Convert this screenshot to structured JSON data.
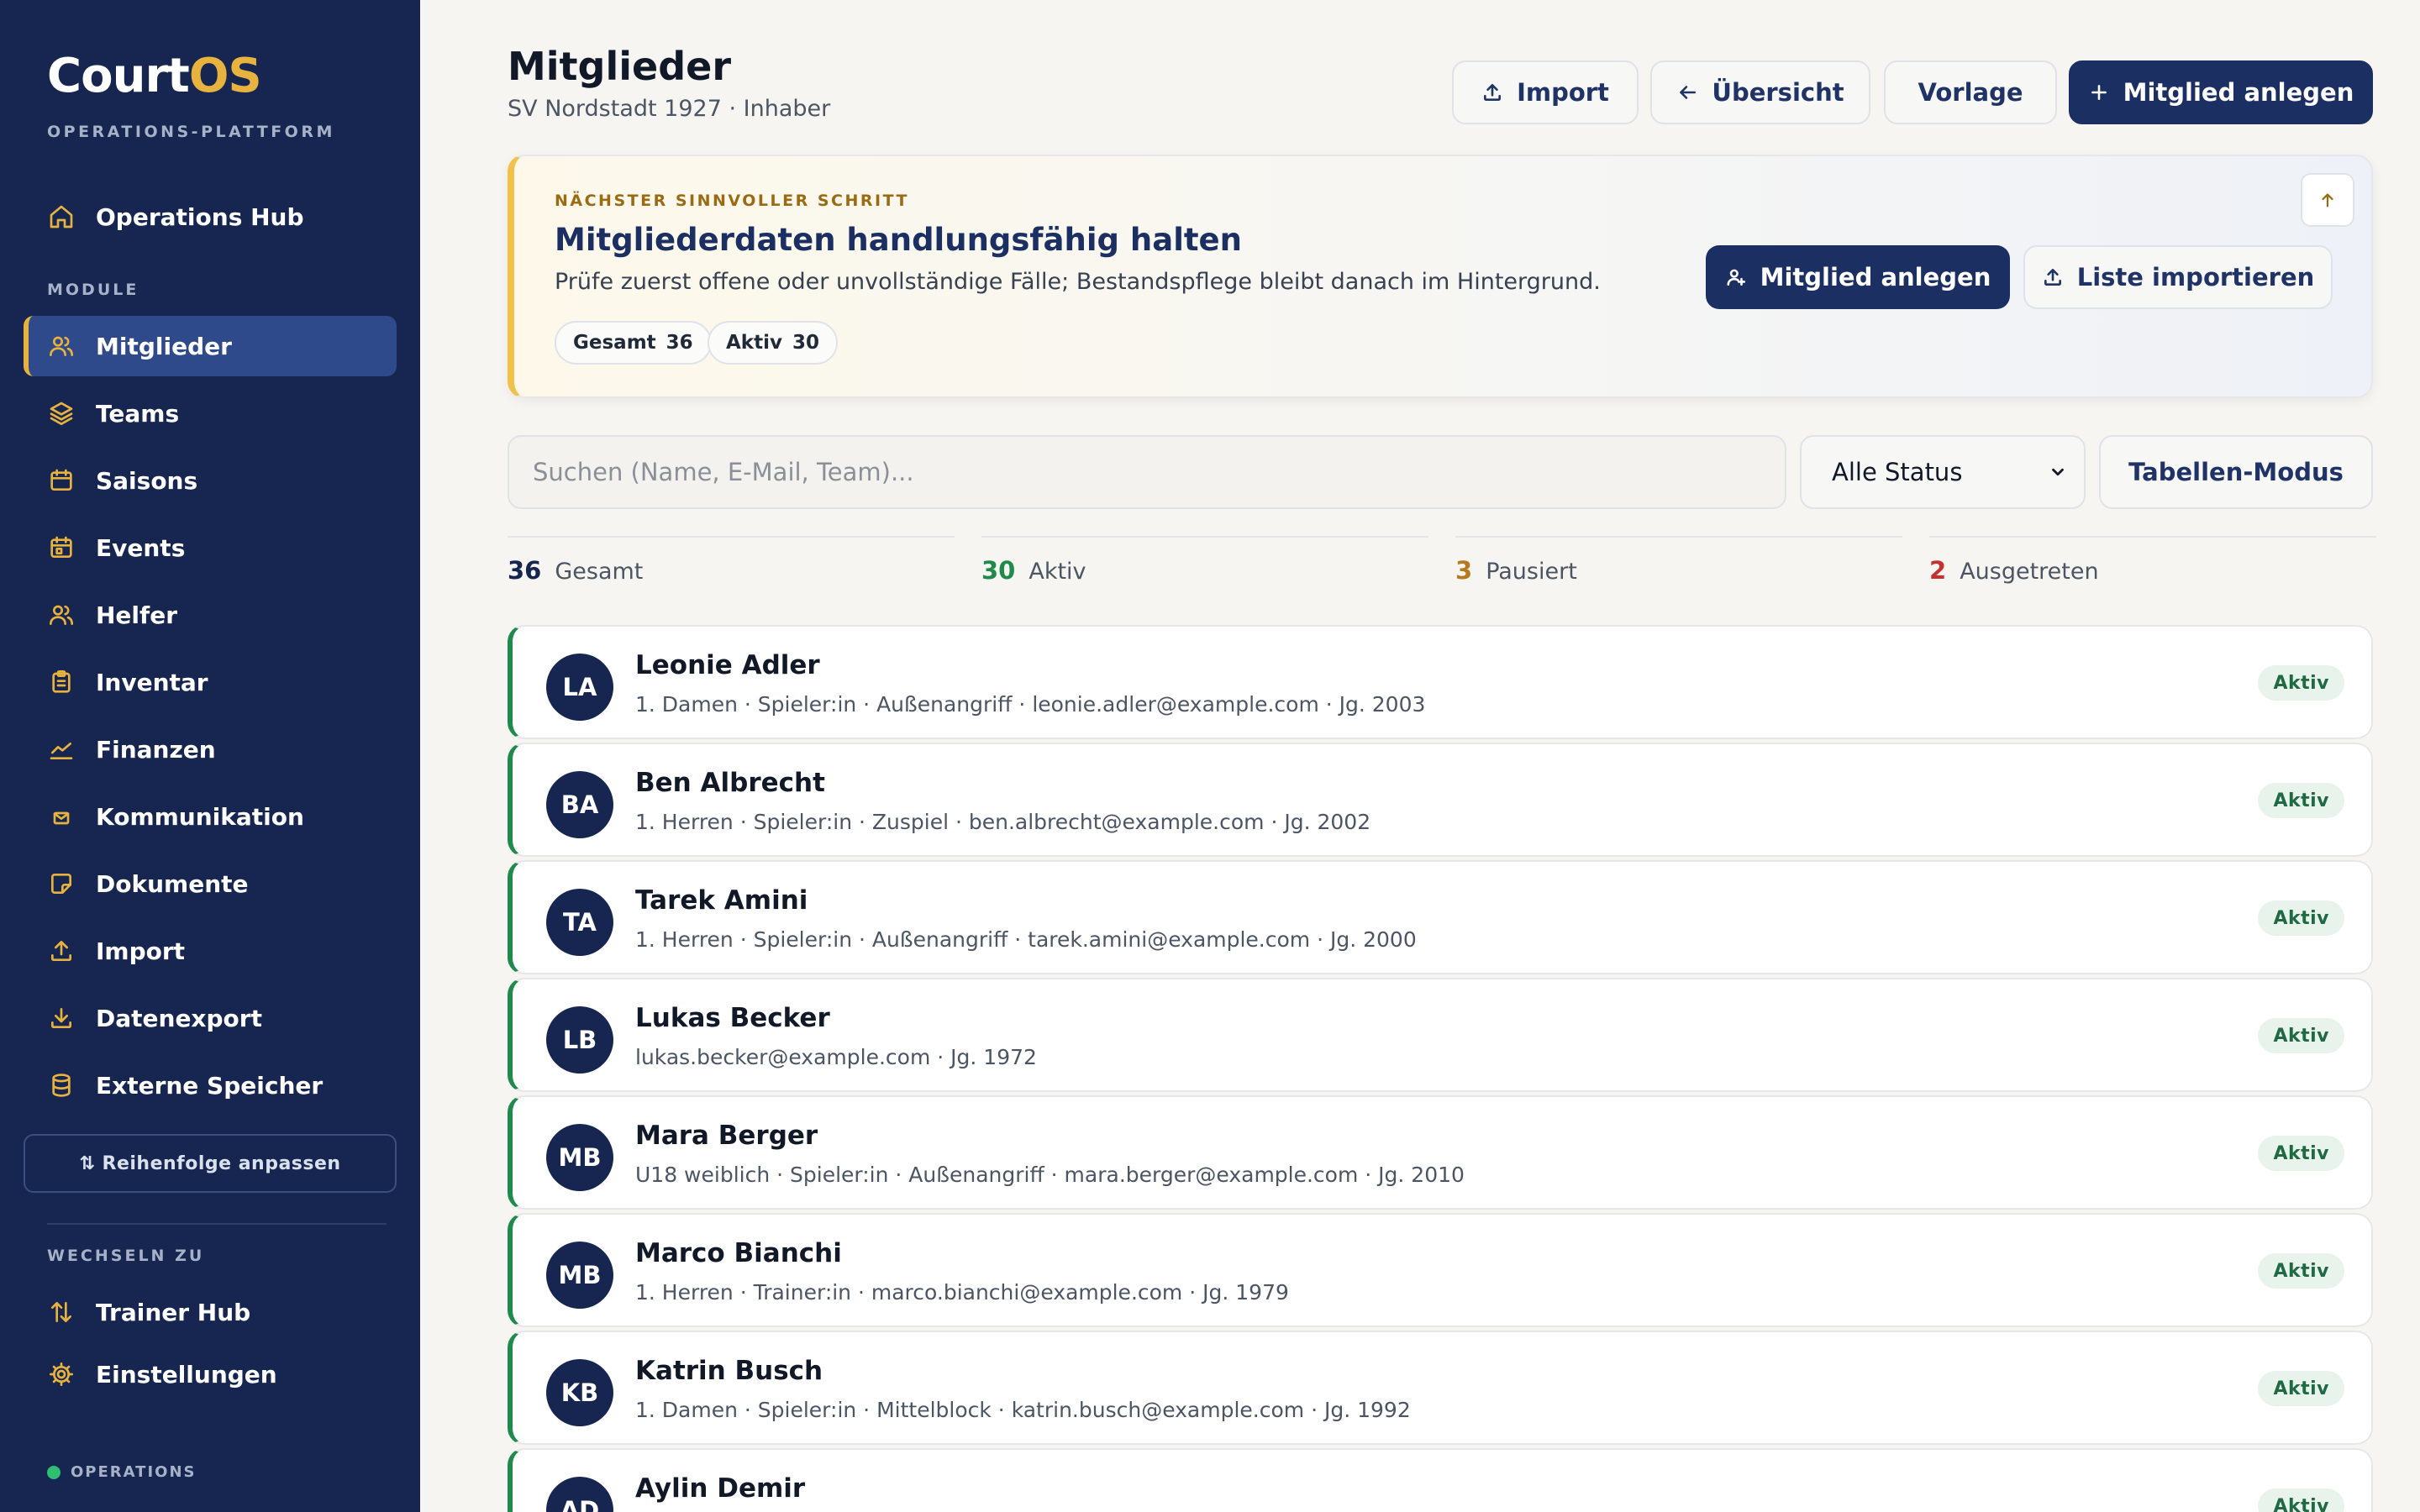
{
  "sidebar": {
    "logo_prefix": "Court",
    "logo_suffix": "OS",
    "subtitle": "OPERATIONS-PLATTFORM",
    "hub_label": "Operations Hub",
    "modules_label": "MODULE",
    "modules": [
      {
        "label": "Mitglieder",
        "icon": "users-icon",
        "active": true
      },
      {
        "label": "Teams",
        "icon": "layers-icon"
      },
      {
        "label": "Saisons",
        "icon": "calendar-icon"
      },
      {
        "label": "Events",
        "icon": "calendar-event-icon"
      },
      {
        "label": "Helfer",
        "icon": "helper-users-icon"
      },
      {
        "label": "Inventar",
        "icon": "clipboard-icon"
      },
      {
        "label": "Finanzen",
        "icon": "chart-line-icon"
      },
      {
        "label": "Kommunikation",
        "icon": "mail-icon"
      },
      {
        "label": "Dokumente",
        "icon": "note-icon"
      },
      {
        "label": "Import",
        "icon": "upload-icon"
      },
      {
        "label": "Datenexport",
        "icon": "download-icon"
      },
      {
        "label": "Externe Speicher",
        "icon": "database-icon"
      }
    ],
    "reorder_label": "⇅ Reihenfolge anpassen",
    "switch_label": "WECHSELN ZU",
    "switch_items": [
      {
        "label": "Trainer Hub",
        "icon": "swap-icon"
      },
      {
        "label": "Einstellungen",
        "icon": "gear-icon"
      }
    ],
    "status_label": "OPERATIONS",
    "accent_color": "#e8b23e",
    "bg_color": "#162650"
  },
  "header": {
    "title": "Mitglieder",
    "subtitle": "SV Nordstadt 1927 · Inhaber",
    "import_label": "Import",
    "overview_label": "Übersicht",
    "template_label": "Vorlage",
    "add_label": "Mitglied anlegen"
  },
  "hint": {
    "kicker": "NÄCHSTER SINNVOLLER SCHRITT",
    "title": "Mitgliederdaten handlungsfähig halten",
    "description": "Prüfe zuerst offene oder unvollständige Fälle; Bestandspflege bleibt danach im Hintergrund.",
    "chip_total_label": "Gesamt",
    "chip_total_value": "36",
    "chip_active_label": "Aktiv",
    "chip_active_value": "30",
    "primary_label": "Mitglied anlegen",
    "secondary_label": "Liste importieren"
  },
  "filters": {
    "search_placeholder": "Suchen (Name, E-Mail, Team)...",
    "status_value": "Alle Status",
    "table_mode_label": "Tabellen-Modus"
  },
  "stats": [
    {
      "value": "36",
      "label": "Gesamt",
      "color": "#162650"
    },
    {
      "value": "30",
      "label": "Aktiv",
      "color": "#1f8a4c"
    },
    {
      "value": "3",
      "label": "Pausiert",
      "color": "#b7791f"
    },
    {
      "value": "2",
      "label": "Ausgetreten",
      "color": "#c53030"
    }
  ],
  "members": [
    {
      "initials": "LA",
      "name": "Leonie Adler",
      "meta": "1. Damen · Spieler:in · Außenangriff · leonie.adler@example.com · Jg. 2003",
      "status": "Aktiv"
    },
    {
      "initials": "BA",
      "name": "Ben Albrecht",
      "meta": "1. Herren · Spieler:in · Zuspiel · ben.albrecht@example.com · Jg. 2002",
      "status": "Aktiv"
    },
    {
      "initials": "TA",
      "name": "Tarek Amini",
      "meta": "1. Herren · Spieler:in · Außenangriff · tarek.amini@example.com · Jg. 2000",
      "status": "Aktiv"
    },
    {
      "initials": "LB",
      "name": "Lukas Becker",
      "meta": "lukas.becker@example.com · Jg. 1972",
      "status": "Aktiv"
    },
    {
      "initials": "MB",
      "name": "Mara Berger",
      "meta": "U18 weiblich · Spieler:in · Außenangriff · mara.berger@example.com · Jg. 2010",
      "status": "Aktiv"
    },
    {
      "initials": "MB",
      "name": "Marco Bianchi",
      "meta": "1. Herren · Trainer:in · marco.bianchi@example.com · Jg. 1979",
      "status": "Aktiv"
    },
    {
      "initials": "KB",
      "name": "Katrin Busch",
      "meta": "1. Damen · Spieler:in · Mittelblock · katrin.busch@example.com · Jg. 1992",
      "status": "Aktiv"
    },
    {
      "initials": "AD",
      "name": "Aylin Demir",
      "meta": "",
      "status": "Aktiv"
    }
  ]
}
